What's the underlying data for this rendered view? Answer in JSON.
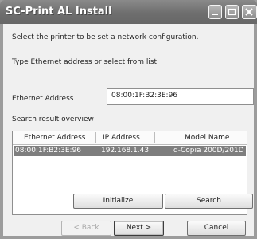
{
  "window": {
    "title": "SC-Print AL Install"
  },
  "content": {
    "instruction1": "Select the printer to be set a network configuration.",
    "instruction2": "Type Ethernet address or select from list.",
    "ethernet_label": "Ethernet Address",
    "ethernet_value": "08:00:1F:B2:3E:96",
    "search_result_label": "Search result overview"
  },
  "list": {
    "columns": [
      "Ethernet Address",
      "IP Address",
      "Model Name"
    ],
    "rows": [
      [
        "08:00:1F:B2:3E:96",
        "192.168.1.43",
        "d-Copia 200D/201D"
      ]
    ]
  },
  "buttons": {
    "initialize": "Initialize",
    "search": "Search",
    "back": "< Back",
    "next": "Next >",
    "cancel": "Cancel"
  },
  "colors": {
    "titlebar": "#6e6e6e",
    "selected_row": "#7e7e7e"
  }
}
